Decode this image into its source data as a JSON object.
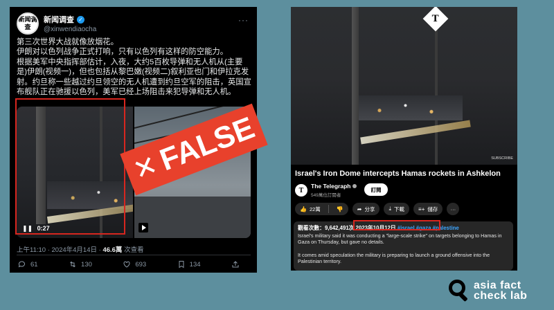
{
  "tweet": {
    "avatar_text": "新闻调查",
    "display_name": "新闻调查",
    "handle": "@xinwendiaocha",
    "more": "···",
    "text": "第三次世界大战就像放烟花。\n伊朗对以色列战争正式打响，只有以色列有这样的防空能力。\n根据美军中央指挥部估计，入夜，大约5百枚导弹和无人机从(主要是)伊朗(视频一)，但也包括从黎巴嫩(视频二)叙利亚也门和伊拉克发射。约旦称一些越过约旦领空的无人机遭到约旦空军的阻击，英国宣布舰队正在驰援以色列，美军已经上场阻击来犯导弹和无人机。",
    "video_time": "0:27",
    "meta_time": "上午11:10 · 2024年4月14日 · ",
    "views_count": "46.6萬",
    "views_label": " 次查看",
    "actions": [
      {
        "icon": "reply-icon",
        "count": "61"
      },
      {
        "icon": "retweet-icon",
        "count": "130"
      },
      {
        "icon": "like-icon",
        "count": "693"
      },
      {
        "icon": "bookmark-icon",
        "count": "134"
      },
      {
        "icon": "share-icon",
        "count": ""
      }
    ]
  },
  "stamp": {
    "mark": "✕",
    "label": "FALSE",
    "color": "#e8412c"
  },
  "youtube": {
    "channel_logo_letter": "T",
    "subscribe_overlay": "SUBSCRIBE",
    "title": "Israel's Iron Dome intercepts Hamas rockets in Ashkelon",
    "channel_name": "The Telegraph",
    "subscribers": "549萬位訂閱者",
    "subscribe_label": "訂閱",
    "like_count": "22萬",
    "share_label": "分享",
    "download_label": "下載",
    "save_label": "儲存",
    "views": "觀看次數：9,642,491次",
    "date": "2023年10月12日",
    "hashtags": "#israel #gaza #palestine",
    "desc_p1": "Israel's military said it was conducting a \"large-scale strike\" on targets belonging to Hamas in Gaza on Thursday, but gave no details.",
    "desc_p2": "It comes amid speculation the military is preparing to launch a ground offensive into the Palestinian territory."
  },
  "brand": {
    "line1": "asia fact",
    "line2": "check lab"
  },
  "colors": {
    "background": "#5d8f9e",
    "highlight_red": "#d8261f",
    "link_blue": "#3ea6ff",
    "verified_blue": "#1d9bf0"
  }
}
